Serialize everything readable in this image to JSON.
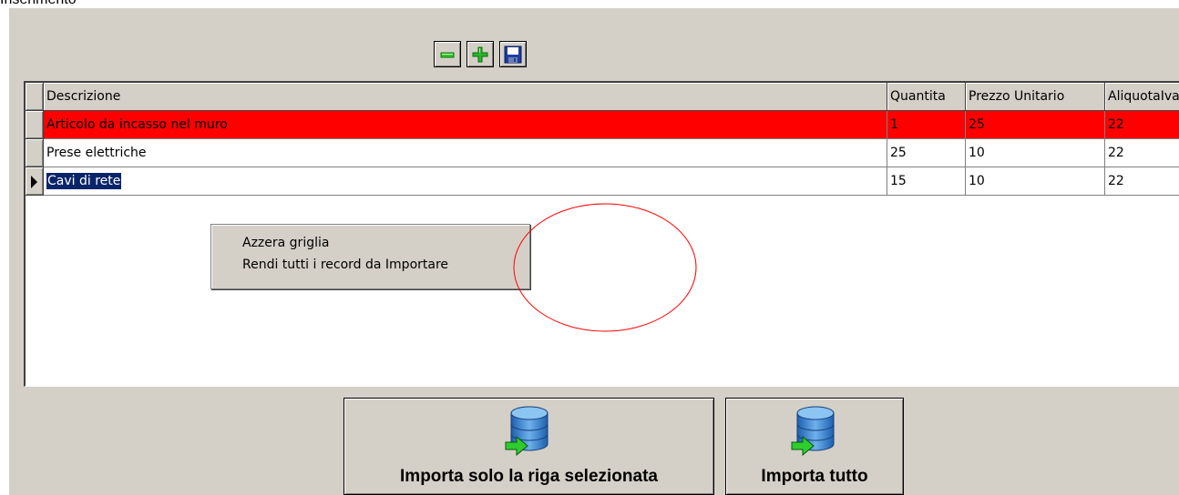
{
  "window": {
    "caption": "Inserimento"
  },
  "toolbar": {
    "remove_icon": "minus-icon",
    "add_icon": "plus-icon",
    "save_icon": "floppy-disk-icon"
  },
  "grid": {
    "columns": [
      "Descrizione",
      "Quantita",
      "Prezzo Unitario",
      "AliquotaIva"
    ],
    "rows": [
      {
        "descrizione": "Articolo da incasso nel muro",
        "quantita": "1",
        "prezzo": "25",
        "iva": "22",
        "highlight": "#ff0000"
      },
      {
        "descrizione": "Prese elettriche",
        "quantita": "25",
        "prezzo": "10",
        "iva": "22"
      },
      {
        "descrizione": "Cavi di rete",
        "quantita": "15",
        "prezzo": "10",
        "iva": "22",
        "selected": true
      }
    ]
  },
  "context_menu": {
    "items": [
      "Azzera griglia",
      "Rendi tutti i record da Importare"
    ]
  },
  "buttons": {
    "import_selected": "Importa solo la riga selezionata",
    "import_all": "Importa tutto",
    "icon": "database-import-icon"
  },
  "annotation": {
    "color": "#ff0000",
    "shape": "ellipse"
  }
}
